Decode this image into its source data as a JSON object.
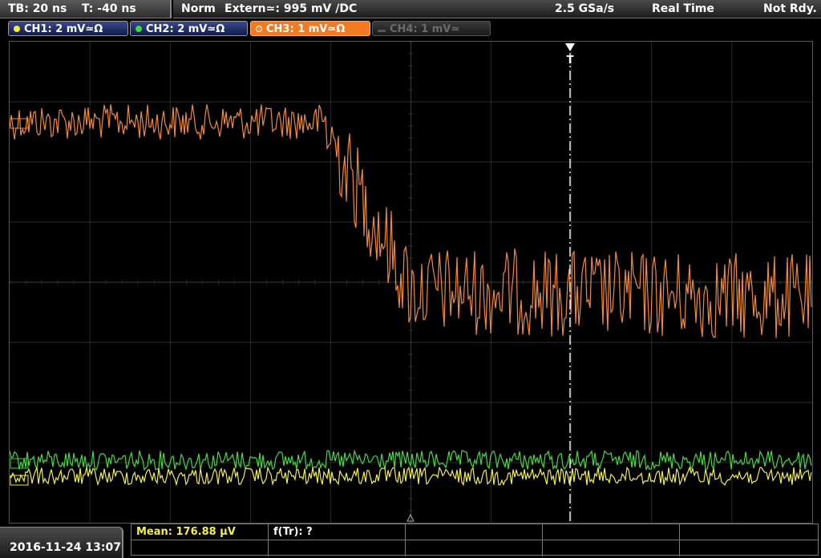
{
  "status": {
    "timebase": "TB: 20 ns",
    "trigger_time": "T: -40 ns",
    "trigger_mode": "Norm",
    "trigger_source": "Extern≃: 995 mV ∕DC",
    "sample_rate": "2.5 GSa/s",
    "acq_mode": "Real Time",
    "trigger_state": "Not Rdy."
  },
  "channels": [
    {
      "label": "CH1: 2 mV≃Ω",
      "color": "#f5f03a",
      "state": "on"
    },
    {
      "label": "CH2: 2 mV≃Ω",
      "color": "#3ddc3d",
      "state": "on"
    },
    {
      "label": "CH3: 1 mV≃Ω",
      "color": "#f58a2c",
      "state": "active"
    },
    {
      "label": "CH4: 1 mV≃",
      "color": "#6a6a6a",
      "state": "off"
    }
  ],
  "trigger_marker": "T",
  "measurements": {
    "mean": "Mean: 176.88 µV",
    "ftr": "f(Tr): ?"
  },
  "datetime": "2016-11-24 13:07",
  "colors": {
    "ch1": "#f5f03a",
    "ch2": "#3ddc3d",
    "ch3": "#f58a2c",
    "grid": "#3a3a3a"
  }
}
